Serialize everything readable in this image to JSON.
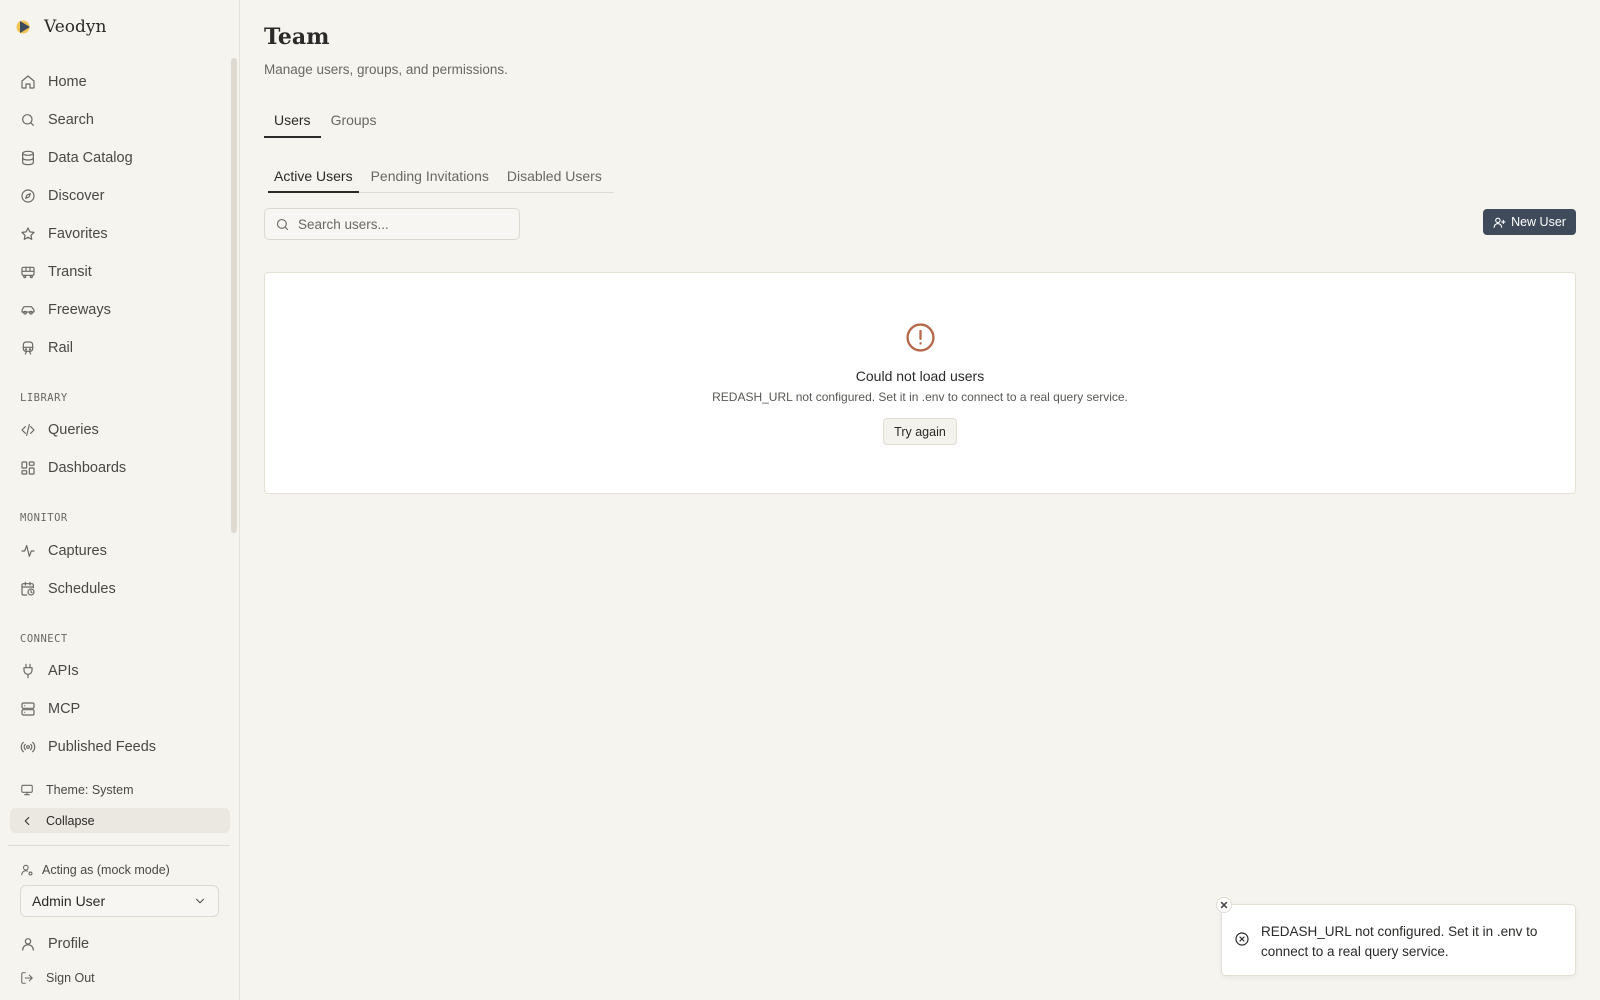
{
  "app": {
    "name": "Veodyn"
  },
  "sidebar": {
    "main_items": [
      {
        "label": "Home",
        "icon": "home-icon"
      },
      {
        "label": "Search",
        "icon": "search-icon"
      },
      {
        "label": "Data Catalog",
        "icon": "database-icon"
      },
      {
        "label": "Discover",
        "icon": "compass-icon"
      },
      {
        "label": "Favorites",
        "icon": "star-icon"
      },
      {
        "label": "Transit",
        "icon": "bus-icon"
      },
      {
        "label": "Freeways",
        "icon": "car-icon"
      },
      {
        "label": "Rail",
        "icon": "train-icon"
      }
    ],
    "library_label": "LIBRARY",
    "library_items": [
      {
        "label": "Queries",
        "icon": "code-icon"
      },
      {
        "label": "Dashboards",
        "icon": "dashboard-icon"
      }
    ],
    "monitor_label": "MONITOR",
    "monitor_items": [
      {
        "label": "Captures",
        "icon": "activity-icon"
      },
      {
        "label": "Schedules",
        "icon": "calendar-clock-icon"
      }
    ],
    "connect_label": "CONNECT",
    "connect_items": [
      {
        "label": "APIs",
        "icon": "plug-icon"
      },
      {
        "label": "MCP",
        "icon": "server-icon"
      },
      {
        "label": "Published Feeds",
        "icon": "radio-icon"
      }
    ],
    "theme_label": "Theme: System",
    "collapse_label": "Collapse",
    "acting_label": "Acting as (mock mode)",
    "acting_user": "Admin User",
    "profile_label": "Profile",
    "signout_label": "Sign Out"
  },
  "main": {
    "title": "Team",
    "subtitle": "Manage users, groups, and permissions.",
    "tabs": [
      {
        "label": "Users",
        "active": true
      },
      {
        "label": "Groups",
        "active": false
      }
    ],
    "subtabs": [
      {
        "label": "Active Users",
        "active": true
      },
      {
        "label": "Pending Invitations",
        "active": false
      },
      {
        "label": "Disabled Users",
        "active": false
      }
    ],
    "search": {
      "placeholder": "Search users..."
    },
    "new_user_label": "New User",
    "error": {
      "title": "Could not load users",
      "message": "REDASH_URL not configured. Set it in .env to connect to a real query service.",
      "retry_label": "Try again",
      "color": "#b5694a"
    }
  },
  "toast": {
    "message": "REDASH_URL not configured. Set it in .env to connect to a real query service."
  }
}
